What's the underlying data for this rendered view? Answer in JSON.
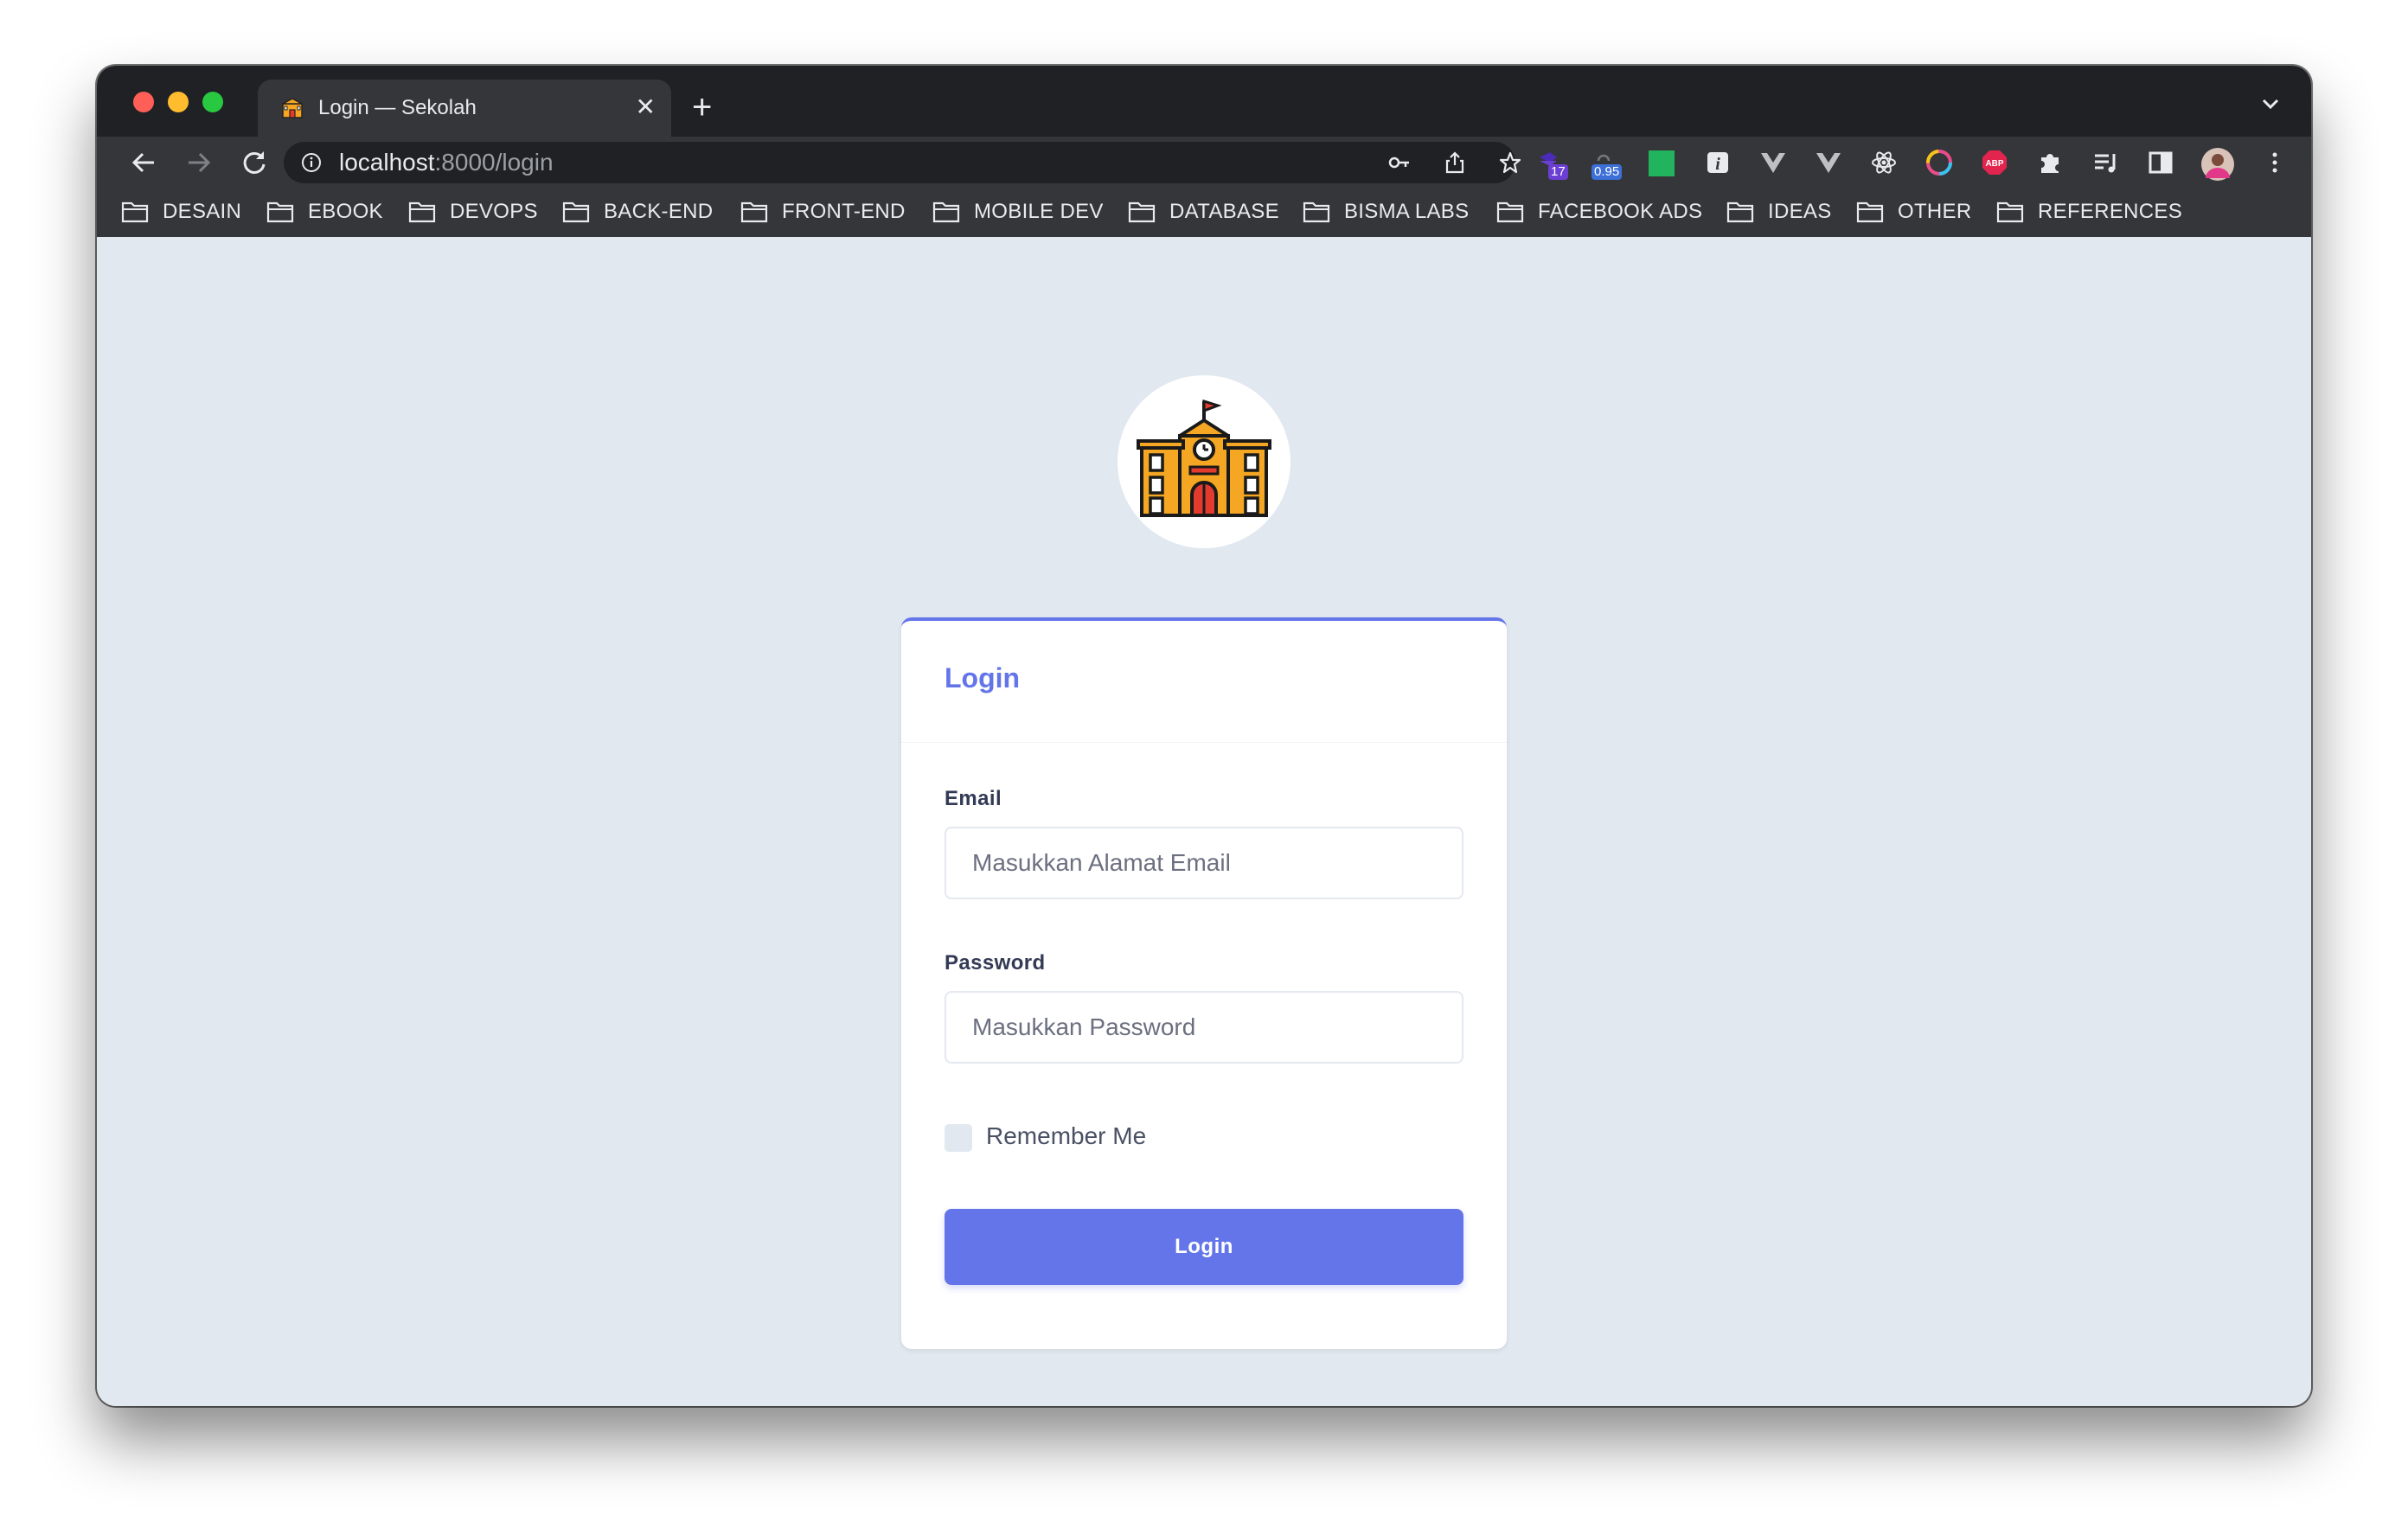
{
  "browser": {
    "tab_title": "Login — Sekolah",
    "url_host": "localhost",
    "url_rest": ":8000/login",
    "extensions": [
      {
        "icon": "wappalyzer-icon",
        "badge": "17",
        "badge_color": "#6b3fd4"
      },
      {
        "icon": "lighthouse-icon",
        "badge": "0.95",
        "badge_color": "#3d6fd8"
      },
      {
        "icon": "green-square-icon"
      },
      {
        "icon": "info-icon"
      },
      {
        "icon": "vue-devtools-icon"
      },
      {
        "icon": "vue-devtools-alt-icon"
      },
      {
        "icon": "react-devtools-icon"
      },
      {
        "icon": "color-picker-icon"
      },
      {
        "icon": "adblock-plus-icon",
        "label": "ABP"
      },
      {
        "icon": "extensions-puzzle-icon"
      },
      {
        "icon": "reading-list-icon"
      },
      {
        "icon": "side-panel-icon"
      },
      {
        "icon": "profile-avatar"
      },
      {
        "icon": "kebab-menu-icon"
      }
    ],
    "bookmarks": [
      "DESAIN",
      "EBOOK",
      "DEVOPS",
      "BACK-END",
      "FRONT-END",
      "MOBILE DEV",
      "DATABASE",
      "BISMA LABS",
      "FACEBOOK ADS",
      "IDEAS",
      "OTHER",
      "REFERENCES"
    ]
  },
  "page": {
    "logo_icon": "school-building-icon",
    "card_title": "Login",
    "email_label": "Email",
    "email_placeholder": "Masukkan Alamat Email",
    "email_value": "",
    "password_label": "Password",
    "password_placeholder": "Masukkan Password",
    "password_value": "",
    "remember_label": "Remember Me",
    "remember_checked": false,
    "submit_label": "Login"
  },
  "colors": {
    "accent": "#6475ea",
    "page_bg": "#e2e8f0",
    "chrome_dark": "#202124",
    "chrome_toolbar": "#35363a"
  }
}
